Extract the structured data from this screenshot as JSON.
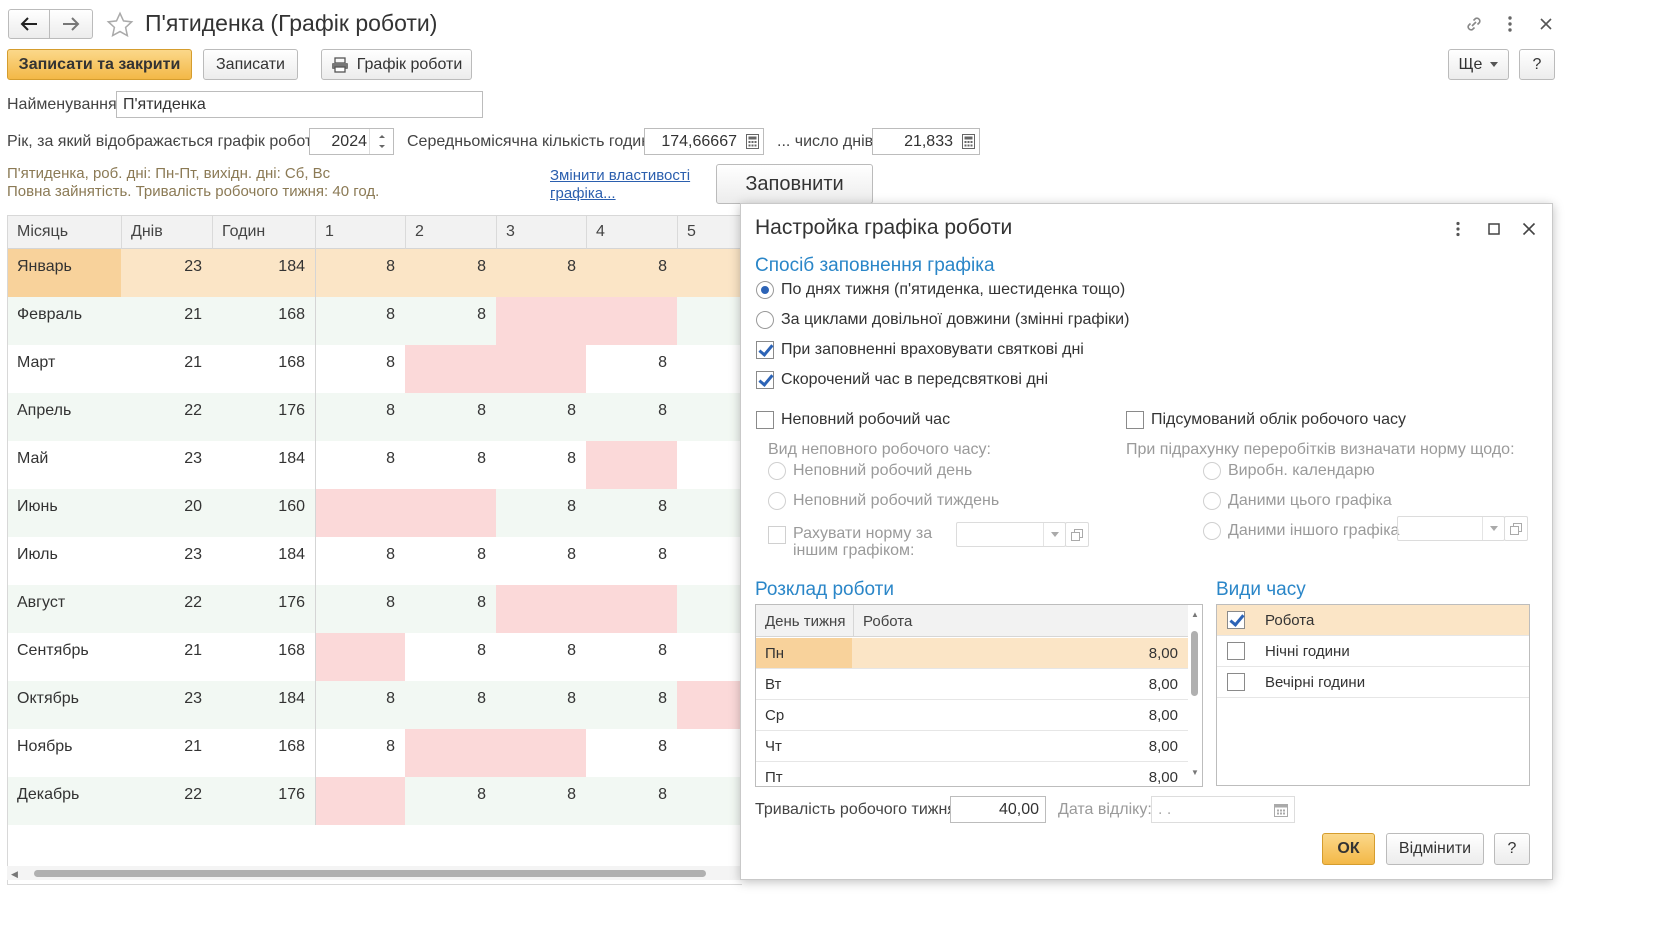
{
  "window": {
    "title": "П'ятиденка (Графік роботи)"
  },
  "toolbar": {
    "save_close": "Записати та закрити",
    "save": "Записати",
    "schedule": "Графік роботи",
    "more": "Ще",
    "help": "?"
  },
  "form": {
    "name_label": "Найменування:",
    "name_value": "П'ятиденка",
    "year_label": "Рік, за який відображається графік роботи:",
    "year_value": "2024",
    "avg_hours_label": "Середньомісячна кількість годин:",
    "avg_hours_value": "174,66667",
    "days_label": "... число днів:",
    "days_value": "21,833",
    "info_line1": "П'ятиденка, роб. дні: Пн-Пт, вихідн. дні: Сб, Вс",
    "info_line2": "Повна зайнятість. Тривалість робочого тижня: 40 год.",
    "change_link_1": "Змінити властивості",
    "change_link_2": "графіка...",
    "fill_button": "Заповнити"
  },
  "grid": {
    "headers": [
      "Місяць",
      "Днів",
      "Годин",
      "1",
      "2",
      "3",
      "4",
      "5"
    ],
    "rows": [
      {
        "month": "Январь",
        "days": "23",
        "hours": "184",
        "d": [
          "8",
          "8",
          "8",
          "8",
          ""
        ],
        "off": [
          false,
          false,
          false,
          false,
          false
        ]
      },
      {
        "month": "Февраль",
        "days": "21",
        "hours": "168",
        "d": [
          "8",
          "8",
          "",
          "",
          ""
        ],
        "off": [
          false,
          false,
          true,
          true,
          false
        ]
      },
      {
        "month": "Март",
        "days": "21",
        "hours": "168",
        "d": [
          "8",
          "",
          "",
          "8",
          ""
        ],
        "off": [
          false,
          true,
          true,
          false,
          false
        ]
      },
      {
        "month": "Апрель",
        "days": "22",
        "hours": "176",
        "d": [
          "8",
          "8",
          "8",
          "8",
          ""
        ],
        "off": [
          false,
          false,
          false,
          false,
          false
        ]
      },
      {
        "month": "Май",
        "days": "23",
        "hours": "184",
        "d": [
          "8",
          "8",
          "8",
          "",
          ""
        ],
        "off": [
          false,
          false,
          false,
          true,
          false
        ]
      },
      {
        "month": "Июнь",
        "days": "20",
        "hours": "160",
        "d": [
          "",
          "",
          "8",
          "8",
          ""
        ],
        "off": [
          true,
          true,
          false,
          false,
          false
        ]
      },
      {
        "month": "Июль",
        "days": "23",
        "hours": "184",
        "d": [
          "8",
          "8",
          "8",
          "8",
          ""
        ],
        "off": [
          false,
          false,
          false,
          false,
          false
        ]
      },
      {
        "month": "Август",
        "days": "22",
        "hours": "176",
        "d": [
          "8",
          "8",
          "",
          "",
          ""
        ],
        "off": [
          false,
          false,
          true,
          true,
          false
        ]
      },
      {
        "month": "Сентябрь",
        "days": "21",
        "hours": "168",
        "d": [
          "",
          "8",
          "8",
          "8",
          ""
        ],
        "off": [
          true,
          false,
          false,
          false,
          false
        ]
      },
      {
        "month": "Октябрь",
        "days": "23",
        "hours": "184",
        "d": [
          "8",
          "8",
          "8",
          "8",
          ""
        ],
        "off": [
          false,
          false,
          false,
          false,
          true
        ]
      },
      {
        "month": "Ноябрь",
        "days": "21",
        "hours": "168",
        "d": [
          "8",
          "",
          "",
          "8",
          ""
        ],
        "off": [
          false,
          true,
          true,
          false,
          false
        ]
      },
      {
        "month": "Декабрь",
        "days": "22",
        "hours": "176",
        "d": [
          "",
          "8",
          "8",
          "8",
          ""
        ],
        "off": [
          true,
          false,
          false,
          false,
          false
        ]
      }
    ]
  },
  "dialog": {
    "title": "Настройка графіка роботи",
    "fill_method_title": "Спосіб заповнення графіка",
    "opt_weekdays": "По днях тижня (п'ятиденка, шестиденка тощо)",
    "opt_cycles": "За циклами довільної довжини (змінні графіки)",
    "chk_holidays": "При заповненні враховувати святкові дні",
    "chk_shortened": "Скорочений час в передсвяткові дні",
    "chk_parttime": "Неповний робочий час",
    "chk_summed": "Підсумований облік робочого часу",
    "parttime_kind_label": "Вид неповного робочого часу:",
    "opt_partday": "Неповний робочий день",
    "opt_partweek": "Неповний робочий тиждень",
    "chk_norm_other_1": "Рахувати норму за",
    "chk_norm_other_2": "іншим графіком:",
    "overtime_label": "При підрахунку переробітків визначати норму щодо:",
    "opt_prod_calendar": "Виробн. календарю",
    "opt_this_schedule": "Даними цього графіка",
    "opt_other_schedule": "Даними іншого графіка",
    "schedule_title": "Розклад роботи",
    "schedule_headers": [
      "День тижня",
      "Робота"
    ],
    "schedule_rows": [
      {
        "day": "Пн",
        "work": "8,00"
      },
      {
        "day": "Вт",
        "work": "8,00"
      },
      {
        "day": "Ср",
        "work": "8,00"
      },
      {
        "day": "Чт",
        "work": "8,00"
      },
      {
        "day": "Пт",
        "work": "8,00"
      }
    ],
    "time_kinds_title": "Види часу",
    "time_kinds": [
      {
        "label": "Робота",
        "checked": true
      },
      {
        "label": "Нічні години",
        "checked": false
      },
      {
        "label": "Вечірні години",
        "checked": false
      }
    ],
    "week_length_label": "Тривалість робочого тижня:",
    "week_length_value": "40,00",
    "ref_date_label": "Дата відліку:",
    "ref_date_value": " .  .",
    "ok": "ОК",
    "cancel": "Відмінити",
    "help": "?"
  },
  "colors": {
    "accent": "#f3b847",
    "weekend": "#fbd9d9",
    "selected_row": "#fbe5c6",
    "stripe": "#f2f8f3",
    "section": "#2a86c8"
  }
}
